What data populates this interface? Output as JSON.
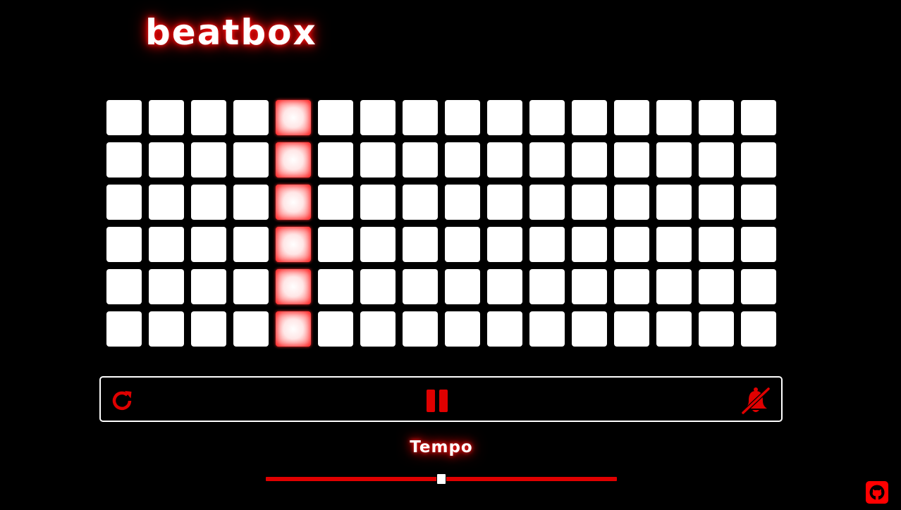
{
  "app": {
    "title": "beatbox"
  },
  "sequencer": {
    "rows": 6,
    "steps": 16,
    "current_step": 5,
    "active_pads": []
  },
  "controls": {
    "reset_icon": "reset-icon",
    "pause_icon": "pause-icon",
    "mute_icon": "bell-slash-icon",
    "state": "playing"
  },
  "tempo": {
    "label": "Tempo",
    "value_fraction": 0.5
  },
  "footer": {
    "github_icon": "github-icon"
  },
  "colors": {
    "accent": "#e00000",
    "background": "#000000",
    "pad": "#ffffff"
  }
}
